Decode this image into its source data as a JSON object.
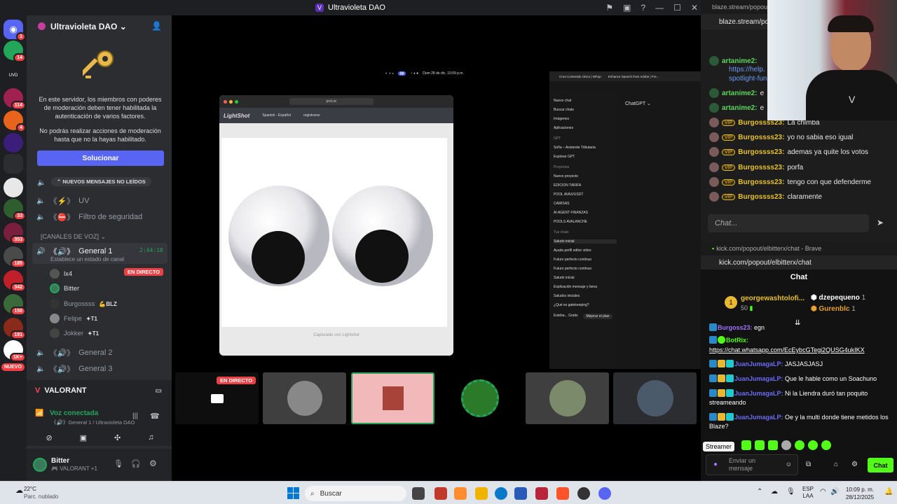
{
  "window": {
    "title": "Ultravioleta DAO"
  },
  "discord": {
    "server_name": "Ultravioleta DAO",
    "mod_notice_1": "En este servidor, los miembros con poderes de moderación deben tener habilitada la autenticación de varios factores.",
    "mod_notice_2": "No podrás realizar acciones de moderación hasta que no la hayas habilitado.",
    "fix_button": "Solucionar",
    "new_messages": "NUEVOS MENSAJES NO LEÍDOS",
    "channels": [
      {
        "name": "UV"
      },
      {
        "name": "Filtro de seguridad"
      }
    ],
    "voice_category": "[CANALES DE VOZ]",
    "voice_channel": {
      "name": "General 1",
      "timer": "2:44:10",
      "status": "Establece un estado de canal"
    },
    "voice_users": [
      {
        "name": "lx4",
        "tag": ""
      },
      {
        "name": "Bitter",
        "tag": ""
      },
      {
        "name": "Burgossss",
        "tag": "BLZ"
      },
      {
        "name": "Felipe",
        "tag": "T1"
      },
      {
        "name": "Jokker",
        "tag": "T1"
      }
    ],
    "live_label": "EN DIRECTO",
    "other_voice": [
      "General 2",
      "General 3"
    ],
    "server_badges": [
      "1",
      "14",
      "114",
      "4",
      "33",
      "353",
      "185",
      "342",
      "150",
      "191",
      "1K+"
    ],
    "new_label": "NUEVO",
    "activity": "VALORANT",
    "voice_connected": "Voz conectada",
    "voice_location": "General 1 / Ultravioleta DAO",
    "user": {
      "name": "Bitter",
      "status": "VALORANT +1"
    }
  },
  "stage": {
    "live_label": "EN DIRECTO",
    "mac_clock": "Dom 28 de dic. 10:09 p.m.",
    "browser_url": "prnt.sc",
    "lightshot": {
      "brand": "LightShot",
      "caption": "Capturado con Lightshot",
      "nav_1": "Spanish - Español",
      "nav_2": "registrarse"
    },
    "chatgpt": {
      "tab_1": "Crea Contenido Único | Whop",
      "tab_2": "Enhance Speech from Adobe | Fre...",
      "model": "ChatGPT",
      "menu": [
        "Nuevo chat",
        "Buscar chats",
        "Imágenes",
        "Aplicaciones"
      ],
      "gpt_header": "GPT",
      "gpts": [
        "Sofía – Asistente Tributaria",
        "Explorar GPT"
      ],
      "projects_header": "Proyectos",
      "projects": [
        "Nuevo proyecto",
        "EDICION TARIFA",
        "POOL AVAX/USDT",
        "CAMISAS",
        "AI AGENT FINANZAS",
        "POOLS AVALANCHE"
      ],
      "chats_header": "Tus chats",
      "chats": [
        "Saludo inicial",
        "Ayuda perfil editor video",
        "Futuro perfecto continuo",
        "Futuro perfecto continuo",
        "Saludo inicial",
        "Explicación mensaje y bena",
        "Saludos iniciales",
        "¿Qué es gatekeeping?"
      ],
      "upgrade": "Mejorar el plan",
      "account": "Esteba... Gratis"
    }
  },
  "blaze": {
    "url": "blaze.stream/popout",
    "url_bar": "blaze.stream/pop",
    "messages": [
      {
        "user": "artanime2:",
        "text": "",
        "vip": false
      },
      {
        "user": "",
        "text": "https://help.",
        "vip": false
      },
      {
        "user": "",
        "text": "spotlight-fun",
        "vip": false
      },
      {
        "user": "artanime2:",
        "text": "e",
        "vip": false
      },
      {
        "user": "artanime2:",
        "text": "e",
        "vip": false
      },
      {
        "user": "Burgossss23:",
        "text": "La chimba",
        "vip": true
      },
      {
        "user": "Burgossss23:",
        "text": "yo no sabia eso igual",
        "vip": true
      },
      {
        "user": "Burgossss23:",
        "text": "ademas ya quite los votos",
        "vip": true
      },
      {
        "user": "Burgossss23:",
        "text": "porfa",
        "vip": true
      },
      {
        "user": "Burgossss23:",
        "text": "tengo con que defenderme",
        "vip": true
      },
      {
        "user": "Burgossss23:",
        "text": "claramente",
        "vip": true
      }
    ],
    "vip_label": "VIP",
    "chat_placeholder": "Chat..."
  },
  "kick": {
    "window_title": "kick.com/popout/elbitterx/chat - Brave",
    "url": "kick.com/popout/elbitterx/chat",
    "header": "Chat",
    "top_gifter": {
      "name": "georgewashtolofi...",
      "count": "50"
    },
    "leaders": [
      {
        "name": "dzepequeno",
        "count": "1"
      },
      {
        "name": "Gurenblc",
        "count": "1"
      }
    ],
    "messages": [
      {
        "user": "Burgoss23:",
        "text": "egn"
      },
      {
        "user": "BotRix:",
        "text": "https://chat.whatsapp.com/EcEybcGTegi2QUSG4ukIKX"
      },
      {
        "user": "JuanJumagaLP:",
        "text": "JASJASJASJ"
      },
      {
        "user": "JuanJumagaLP:",
        "text": "Que le hable como un Soachuno"
      },
      {
        "user": "JuanJumagaLP:",
        "text": "Ni la Liendra duró tan poquito streameando"
      },
      {
        "user": "JuanJumagaLP:",
        "text": "Oe y la multi donde tiene metidos los Blaze?"
      }
    ],
    "tooltip": "Streamer",
    "input_placeholder": "Enviar un mensaje",
    "send_label": "Chat"
  },
  "taskbar": {
    "weather_temp": "22°C",
    "weather_desc": "Parc. nublado",
    "search": "Buscar",
    "lang_1": "ESP",
    "lang_2": "LAA",
    "time": "10:09 p. m.",
    "date": "28/12/2025"
  }
}
